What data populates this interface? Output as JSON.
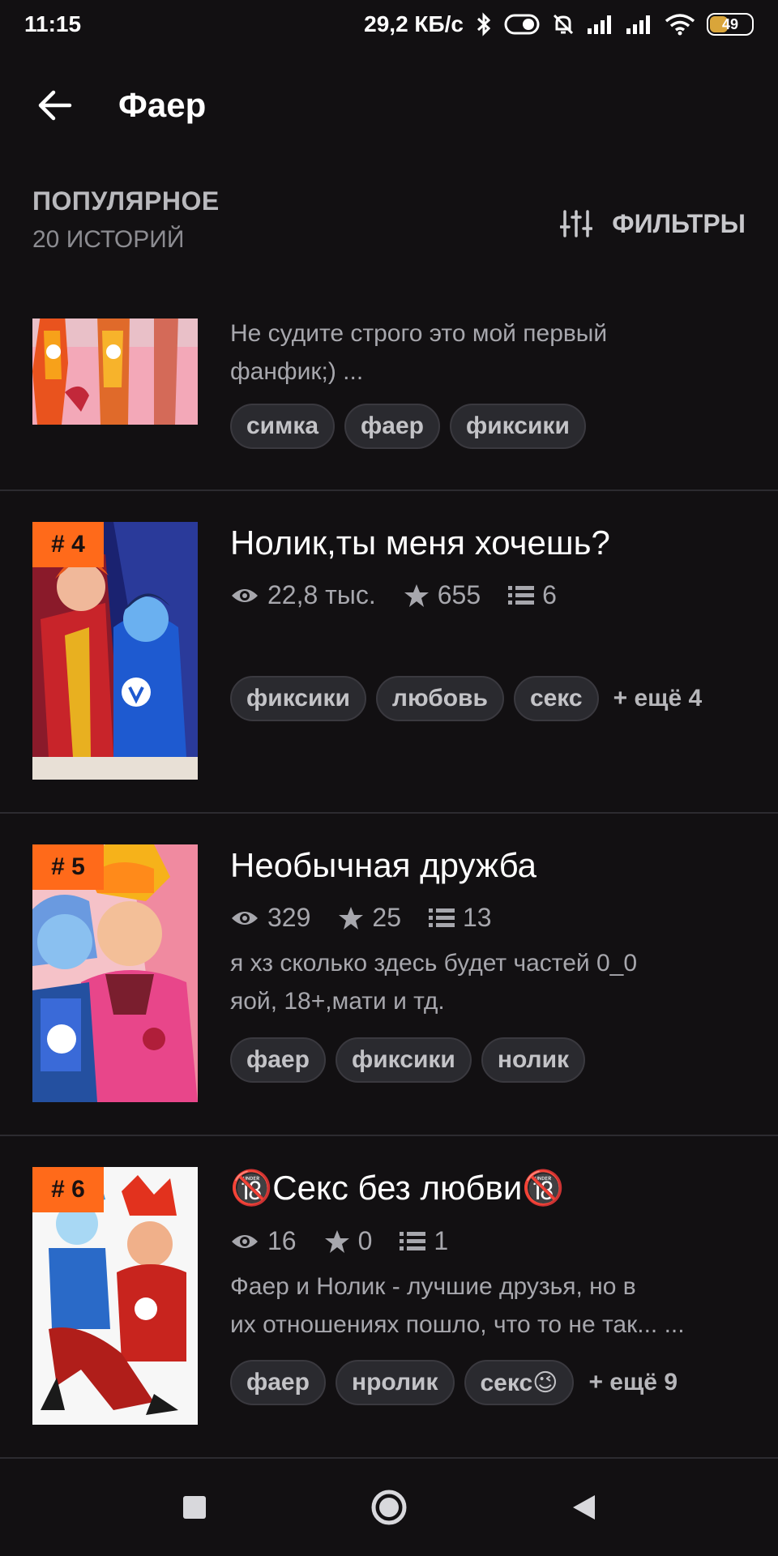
{
  "status": {
    "time": "11:15",
    "speed": "29,2 КБ/с",
    "battery": "49",
    "battery_level": 0.49
  },
  "header": {
    "title": "Фаер"
  },
  "section": {
    "title": "ПОПУЛЯРНОЕ",
    "count": "20 ИСТОРИЙ",
    "filters_label": "ФИЛЬТРЫ"
  },
  "stories": [
    {
      "desc": "Не судите строго это мой первый фанфик;) ...",
      "tags": [
        "симка",
        "фаер",
        "фиксики"
      ]
    },
    {
      "rank": "# 4",
      "title": "Нолик,ты меня хочешь?",
      "views": "22,8 тыс.",
      "stars": "655",
      "parts": "6",
      "tags": [
        "фиксики",
        "любовь",
        "секс"
      ],
      "more": "+ ещё 4"
    },
    {
      "rank": "# 5",
      "title": "Необычная дружба",
      "views": "329",
      "stars": "25",
      "parts": "13",
      "desc_line1": "я хз сколько здесь будет частей 0_0",
      "desc_line2": "яой, 18+,мати и тд.",
      "tags": [
        "фаер",
        "фиксики",
        "нолик"
      ]
    },
    {
      "rank": "# 6",
      "title": "🔞Секс без любви🔞",
      "views": "16",
      "stars": "0",
      "parts": "1",
      "desc_line1": "Фаер и Нолик - лучшие друзья, но в",
      "desc_line2": "их отношениях пошло, что то не так... ...",
      "tags": [
        "фаер",
        "нролик",
        "секс😉"
      ],
      "more": "+ ещё 9"
    }
  ],
  "colors": {
    "background": "#121012",
    "rank_badge": "#ff6a1a",
    "tag_bg": "#2a2a2f",
    "text_secondary": "#a7a7ad"
  },
  "icons": [
    "bluetooth-icon",
    "mute-icon",
    "signal-icon",
    "wifi-icon",
    "battery-icon",
    "back-arrow-icon",
    "filter-sliders-icon",
    "eye-icon",
    "star-icon",
    "list-icon",
    "square-nav-icon",
    "circle-nav-icon",
    "triangle-back-nav-icon"
  ]
}
